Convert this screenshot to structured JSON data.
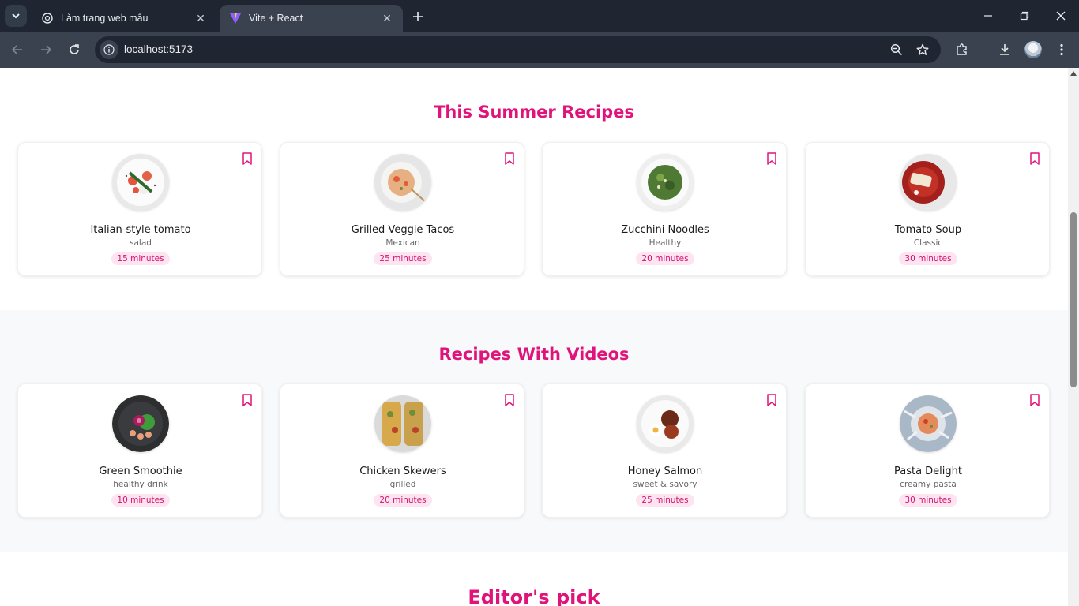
{
  "browser": {
    "tabs": [
      {
        "title": "Làm trang web mẫu",
        "active": false
      },
      {
        "title": "Vite + React",
        "active": true
      }
    ],
    "url": "localhost:5173"
  },
  "sections": [
    {
      "title": "This Summer Recipes",
      "cards": [
        {
          "name": "Italian-style tomato",
          "category": "salad",
          "time": "15 minutes"
        },
        {
          "name": "Grilled Veggie Tacos",
          "category": "Mexican",
          "time": "25 minutes"
        },
        {
          "name": "Zucchini Noodles",
          "category": "Healthy",
          "time": "20 minutes"
        },
        {
          "name": "Tomato Soup",
          "category": "Classic",
          "time": "30 minutes"
        }
      ]
    },
    {
      "title": "Recipes With Videos",
      "cards": [
        {
          "name": "Green Smoothie",
          "category": "healthy drink",
          "time": "10 minutes"
        },
        {
          "name": "Chicken Skewers",
          "category": "grilled",
          "time": "20 minutes"
        },
        {
          "name": "Honey Salmon",
          "category": "sweet & savory",
          "time": "25 minutes"
        },
        {
          "name": "Pasta Delight",
          "category": "creamy pasta",
          "time": "30 minutes"
        }
      ]
    },
    {
      "title": "Editor's pick"
    }
  ],
  "colors": {
    "accent": "#e0137a",
    "badge_bg": "#fde4f0",
    "chrome_dark": "#1f2631",
    "chrome_mid": "#3a4250"
  }
}
